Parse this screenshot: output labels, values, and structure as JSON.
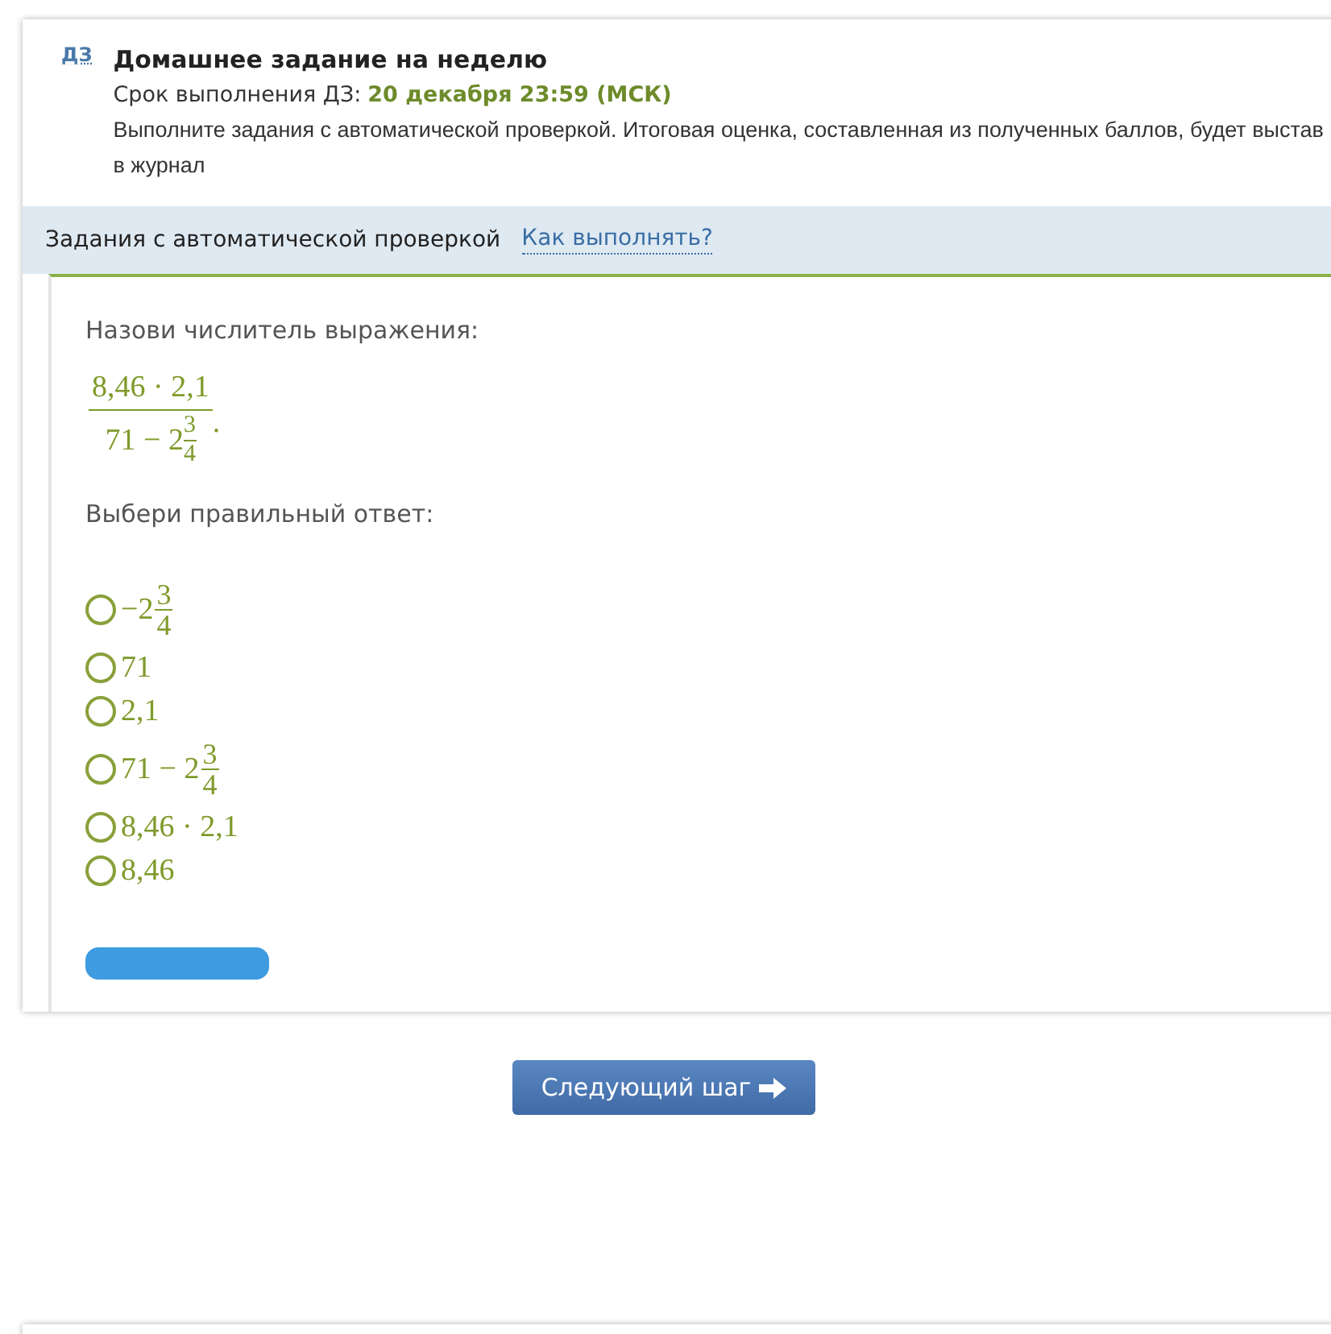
{
  "header": {
    "badge": "ДЗ",
    "title": "Домашнее задание на неделю",
    "deadline_label": "Срок выполнения ДЗ:",
    "deadline_value": "20 декабря 23:59 (МСК)",
    "description": "Выполните задания с автоматической проверкой. Итоговая оценка, составленная из полученных баллов, будет выстав\nв журнал"
  },
  "section_bar": {
    "title": "Задания с автоматической проверкой",
    "help_link": "Как выполнять?"
  },
  "task": {
    "prompt": "Назови числитель выражения:",
    "expression": {
      "numerator": "8,46 · 2,1",
      "denominator_prefix": "71 − 2",
      "denominator_num": "3",
      "denominator_den": "4",
      "suffix": "."
    },
    "answer_prompt": "Выбери правильный ответ:",
    "options": [
      {
        "kind": "mixed",
        "prefix": "−2",
        "num": "3",
        "den": "4",
        "selected": false
      },
      {
        "kind": "plain",
        "text": "71",
        "selected": false
      },
      {
        "kind": "plain",
        "text": "2,1",
        "selected": false
      },
      {
        "kind": "mixed",
        "prefix": "71 − 2",
        "num": "3",
        "den": "4",
        "selected": false
      },
      {
        "kind": "plain",
        "text": "8,46 · 2,1",
        "selected": false
      },
      {
        "kind": "plain",
        "text": "8,46",
        "selected": false
      }
    ]
  },
  "next_button": "Следующий шаг"
}
